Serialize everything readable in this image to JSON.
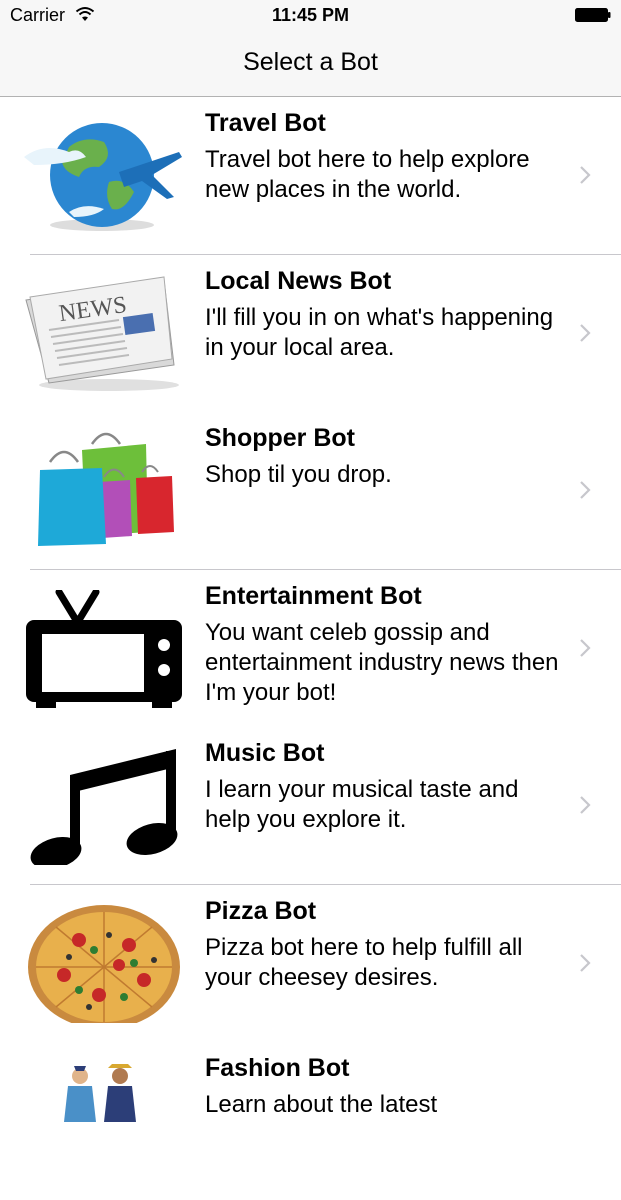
{
  "status": {
    "carrier": "Carrier",
    "time": "11:45 PM"
  },
  "nav": {
    "title": "Select a Bot"
  },
  "bots": [
    {
      "title": "Travel Bot",
      "description": "Travel bot here to help explore new places in the world.",
      "icon": "globe-plane-icon"
    },
    {
      "title": "Local News Bot",
      "description": "I'll fill you in on what's happening in your local area.",
      "icon": "newspaper-icon",
      "icon_text": "NEWS"
    },
    {
      "title": "Shopper Bot",
      "description": "Shop til you drop.",
      "icon": "shopping-bags-icon"
    },
    {
      "title": "Entertainment Bot",
      "description": "You want celeb gossip and entertainment industry news then I'm your bot!",
      "icon": "tv-icon"
    },
    {
      "title": "Music Bot",
      "description": "I learn your musical taste and help you explore it.",
      "icon": "music-note-icon"
    },
    {
      "title": "Pizza Bot",
      "description": "Pizza bot here to help fulfill all your cheesey desires.",
      "icon": "pizza-icon"
    },
    {
      "title": "Fashion Bot",
      "description": "Learn about the latest",
      "icon": "fashion-figures-icon"
    }
  ],
  "colors": {
    "chevron": "#c7c7cc",
    "separator": "#c8c7cc",
    "bar": "#f7f7f7"
  }
}
